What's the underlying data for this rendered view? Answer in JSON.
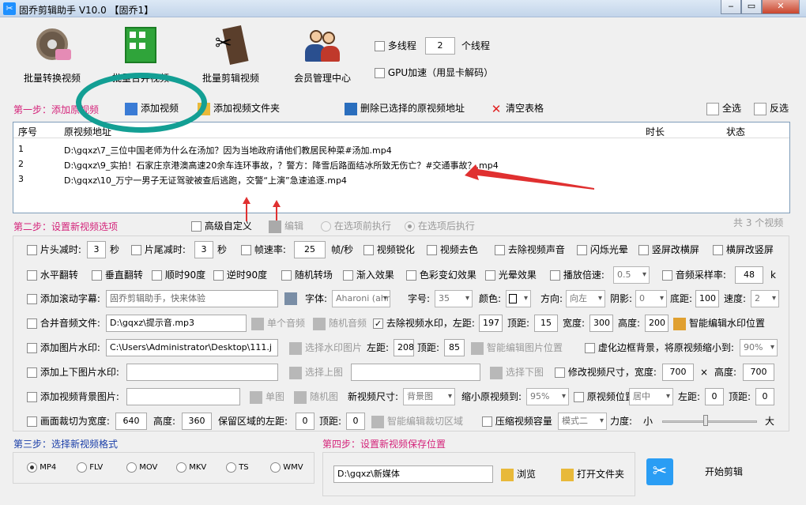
{
  "window": {
    "title": "固乔剪辑助手 V10.0 【固乔1】"
  },
  "toolbar": {
    "items": [
      "批量转换视频",
      "批量合并视频",
      "批量剪辑视频",
      "会员管理中心"
    ],
    "multithread_label": "多线程",
    "thread_count": "2",
    "thread_unit": "个线程",
    "gpu_label": "GPU加速（用显卡解码）"
  },
  "step1": {
    "label": "第一步：添加原视频",
    "add_video": "添加视频",
    "add_folder": "添加视频文件夹",
    "delete_selected": "删除已选择的原视频地址",
    "clear": "清空表格",
    "select_all": "全选",
    "invert": "反选"
  },
  "table": {
    "columns": [
      "序号",
      "原视频地址",
      "时长",
      "状态"
    ],
    "rows": [
      {
        "no": "1",
        "path": "D:\\gqxz\\7_三位中国老师为什么在汤加？因为当地政府请他们教居民种菜#汤加.mp4"
      },
      {
        "no": "2",
        "path": "D:\\gqxz\\9_实拍！石家庄京港澳高速20余车连环事故，？警方：降雪后路面结冰所致无伤亡？#交通事故？.mp4"
      },
      {
        "no": "3",
        "path": "D:\\gqxz\\10_万宁一男子无证驾驶被查后逃跑，交警“上演”急速追逐.mp4"
      }
    ]
  },
  "step2": {
    "label": "第二步：设置新视频选项",
    "advanced": "高级自定义",
    "edit": "编辑",
    "before": "在选项前执行",
    "after": "在选项后执行",
    "count": "共 3 个视频"
  },
  "opts": {
    "r1": {
      "head": "片头减时:",
      "head_val": "3",
      "sec": "秒",
      "tail": "片尾减时:",
      "tail_val": "3",
      "sec2": "秒",
      "fps": "帧速率:",
      "fps_val": "25",
      "fps_unit": "帧/秒",
      "sharpen": "视频锐化",
      "denoise": "视频去色",
      "mute": "去除视频声音",
      "flash": "闪烁光晕",
      "v2h": "竖屏改横屏",
      "h2v": "横屏改竖屏"
    },
    "r2": {
      "hflip": "水平翻转",
      "vflip": "垂直翻转",
      "cw": "顺时90度",
      "ccw": "逆时90度",
      "rand": "随机转场",
      "fadein": "渐入效果",
      "color": "色彩变幻效果",
      "halo": "光晕效果",
      "speed": "播放倍速:",
      "speed_val": "0.5",
      "sample": "音频采样率:",
      "sample_val": "48",
      "k": "k"
    },
    "r3": {
      "scroll": "添加滚动字幕:",
      "scroll_text": "固乔剪辑助手，快来体验",
      "font": "字体:",
      "font_val": "Aharoni (ahr",
      "size": "字号:",
      "size_val": "35",
      "color": "颜色:",
      "dir": "方向:",
      "dir_val": "向左",
      "shadow": "阴影:",
      "shadow_val": "0",
      "bottom": "底距:",
      "bottom_val": "100",
      "speed": "速度:",
      "speed_val": "2"
    },
    "r4": {
      "merge": "合并音频文件:",
      "merge_path": "D:\\gqxz\\提示音.mp3",
      "single": "单个音频",
      "random": "随机音频",
      "wm": "去除视频水印，左距:",
      "left": "197",
      "top_l": "顶距:",
      "top": "15",
      "w_l": "宽度:",
      "w": "300",
      "h_l": "高度:",
      "h": "200",
      "smart": "智能编辑水印位置"
    },
    "r5": {
      "img": "添加图片水印:",
      "img_path": "C:\\Users\\Administrator\\Desktop\\111.j",
      "choose": "选择水印图片",
      "left_l": "左距:",
      "left": "208",
      "top_l": "顶距:",
      "top": "85",
      "smart": "智能编辑图片位置",
      "blur": "虚化边框背景，将原视频缩小到:",
      "blur_val": "90%"
    },
    "r6": {
      "updown": "添加上下图片水印:",
      "up": "选择上图",
      "down": "选择下图",
      "resize": "修改视频尺寸，宽度:",
      "w": "700",
      "x": "×",
      "h_l": "高度:",
      "h": "700"
    },
    "r7": {
      "bg": "添加视频背景图片:",
      "single": "单图",
      "random": "随机图",
      "size": "新视频尺寸:",
      "size_val": "背景图",
      "shrink": "缩小原视频到:",
      "shrink_val": "95%",
      "pos": "原视频位置:",
      "pos_val": "居中",
      "left_l": "左距:",
      "left": "0",
      "top_l": "顶距:",
      "top": "0"
    },
    "r8": {
      "crop": "画面裁切为宽度:",
      "cw": "640",
      "ch_l": "高度:",
      "ch": "360",
      "keep": "保留区域的左距:",
      "kl": "0",
      "kt_l": "顶距:",
      "kt": "0",
      "smart": "智能编辑裁切区域",
      "compress": "压缩视频容量",
      "mode": "模式二",
      "force": "力度:",
      "small": "小",
      "big": "大"
    }
  },
  "step3": {
    "label": "第三步：选择新视频格式",
    "formats": [
      "MP4",
      "FLV",
      "MOV",
      "MKV",
      "TS",
      "WMV"
    ]
  },
  "step4": {
    "label": "第四步：设置新视频保存位置",
    "path": "D:\\gqxz\\新媒体",
    "browse": "浏览",
    "open": "打开文件夹",
    "start": "开始剪辑"
  }
}
